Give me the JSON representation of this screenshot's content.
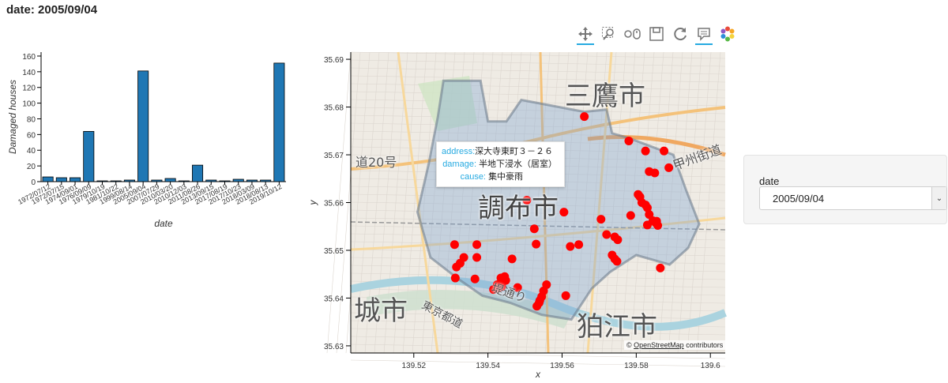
{
  "page_title": "date: 2005/09/04",
  "toolbar": {
    "tools": [
      "pan-tool",
      "box-zoom-tool",
      "wheel-zoom-tool",
      "save-tool",
      "reset-tool",
      "hover-tool",
      "bokeh-logo"
    ]
  },
  "widget": {
    "label": "date",
    "selected": "2005/09/04"
  },
  "tooltip": {
    "address_key": "address:",
    "address_val": "深大寺東町３－２６",
    "damage_key": "damage:",
    "damage_val": "半地下浸水（居室）",
    "cause_key": "cause:",
    "cause_val": "集中豪雨"
  },
  "map_labels": {
    "mitaka": "三鷹市",
    "chofu": "調布市",
    "komae": "狛江市",
    "shiro": "城市",
    "route20": "道20号",
    "koshu": "甲州街道",
    "tokyo": "東京都道",
    "tei": "堤通り"
  },
  "attribution_link": "OpenStreetMap",
  "attribution_text": "contributors",
  "colors": {
    "bar_fill": "#1f77b4",
    "point": "#ff0000",
    "accent": "#26aae1"
  },
  "chart_data": [
    {
      "type": "bar",
      "xlabel": "date",
      "ylabel": "Damaged houses",
      "ylim": [
        0,
        165
      ],
      "yticks": [
        0,
        20,
        40,
        60,
        80,
        100,
        120,
        140,
        160
      ],
      "categories": [
        "1972/07/12",
        "1972/07/15",
        "1974/09/01",
        "1976/09/09",
        "1979/10/19",
        "1981/10/22",
        "1999/08/14",
        "2005/09/04",
        "2007/07/29",
        "2010/03/20",
        "2010/12/03",
        "2011/08/26",
        "2013/09/15",
        "2017/08/19",
        "2017/10/23",
        "2018/03/09",
        "2018/08/13",
        "2019/10/12"
      ],
      "values": [
        6,
        5,
        5,
        64,
        1,
        1,
        2,
        141,
        2,
        4,
        1,
        21,
        2,
        1,
        3,
        2,
        2,
        151
      ]
    },
    {
      "type": "scatter",
      "xlabel": "x",
      "ylabel": "y",
      "xlim": [
        139.503,
        139.604
      ],
      "ylim": [
        139.0,
        139.0
      ],
      "y_range": [
        35.6285,
        35.6915
      ],
      "xticks": [
        139.52,
        139.54,
        139.56,
        139.58,
        139.6
      ],
      "yticks": [
        35.63,
        35.64,
        35.65,
        35.66,
        35.67,
        35.68,
        35.69
      ],
      "points": [
        [
          139.531,
          35.6512
        ],
        [
          139.5335,
          35.6485
        ],
        [
          139.5325,
          35.6473
        ],
        [
          139.5315,
          35.6465
        ],
        [
          139.537,
          35.6512
        ],
        [
          139.537,
          35.6485
        ],
        [
          139.5312,
          35.6442
        ],
        [
          139.5365,
          35.644
        ],
        [
          139.5415,
          35.6418
        ],
        [
          139.5425,
          35.6428
        ],
        [
          139.5435,
          35.6442
        ],
        [
          139.5445,
          35.6445
        ],
        [
          139.5448,
          35.6437
        ],
        [
          139.5437,
          35.6424
        ],
        [
          139.5428,
          35.6421
        ],
        [
          139.5465,
          35.6482
        ],
        [
          139.548,
          35.6422
        ],
        [
          139.5525,
          35.6545
        ],
        [
          139.553,
          35.6513
        ],
        [
          139.561,
          35.6405
        ],
        [
          139.5558,
          35.6428
        ],
        [
          139.555,
          35.6415
        ],
        [
          139.5545,
          35.6403
        ],
        [
          139.554,
          35.6395
        ],
        [
          139.5532,
          35.6383
        ],
        [
          139.5538,
          35.639
        ],
        [
          139.5505,
          35.6605
        ],
        [
          139.5605,
          35.658
        ],
        [
          139.5622,
          35.6508
        ],
        [
          139.5645,
          35.6512
        ],
        [
          139.566,
          35.678
        ],
        [
          139.5705,
          35.6565
        ],
        [
          139.572,
          35.6533
        ],
        [
          139.575,
          35.6522
        ],
        [
          139.5742,
          35.6528
        ],
        [
          139.5735,
          35.649
        ],
        [
          139.5742,
          35.6482
        ],
        [
          139.5748,
          35.6477
        ],
        [
          139.5785,
          35.6573
        ],
        [
          139.578,
          35.6729
        ],
        [
          139.5825,
          35.6708
        ],
        [
          139.5805,
          35.6617
        ],
        [
          139.581,
          35.6612
        ],
        [
          139.5815,
          35.66
        ],
        [
          139.5825,
          35.6595
        ],
        [
          139.583,
          35.6589
        ],
        [
          139.5835,
          35.6575
        ],
        [
          139.5845,
          35.6562
        ],
        [
          139.5852,
          35.6558
        ],
        [
          139.5858,
          35.6552
        ],
        [
          139.583,
          35.6553
        ],
        [
          139.5835,
          35.6665
        ],
        [
          139.585,
          35.6662
        ],
        [
          139.5855,
          35.6561
        ],
        [
          139.5875,
          35.6708
        ],
        [
          139.5888,
          35.6673
        ],
        [
          139.5865,
          35.6463
        ]
      ]
    }
  ]
}
